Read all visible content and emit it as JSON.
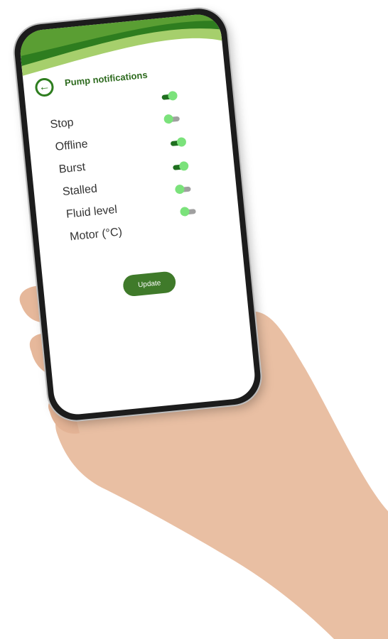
{
  "screen": {
    "title": "Pump notifications"
  },
  "notifications": [
    {
      "label": "Stop",
      "enabled": true
    },
    {
      "label": "Offline",
      "enabled": false
    },
    {
      "label": "Burst",
      "enabled": true
    },
    {
      "label": "Stalled",
      "enabled": true
    },
    {
      "label": "Fluid level",
      "enabled": false
    },
    {
      "label": "Motor (°C)",
      "enabled": false
    }
  ],
  "actions": {
    "update_label": "Update"
  },
  "icons": {
    "back": "arrow-left-icon"
  },
  "colors": {
    "primary": "#2e7d1f",
    "header_light": "#a6cf6c",
    "toggle_on_track": "#1f6f1f",
    "toggle_knob": "#7be27b",
    "toggle_off_track": "#a0a0a0"
  }
}
